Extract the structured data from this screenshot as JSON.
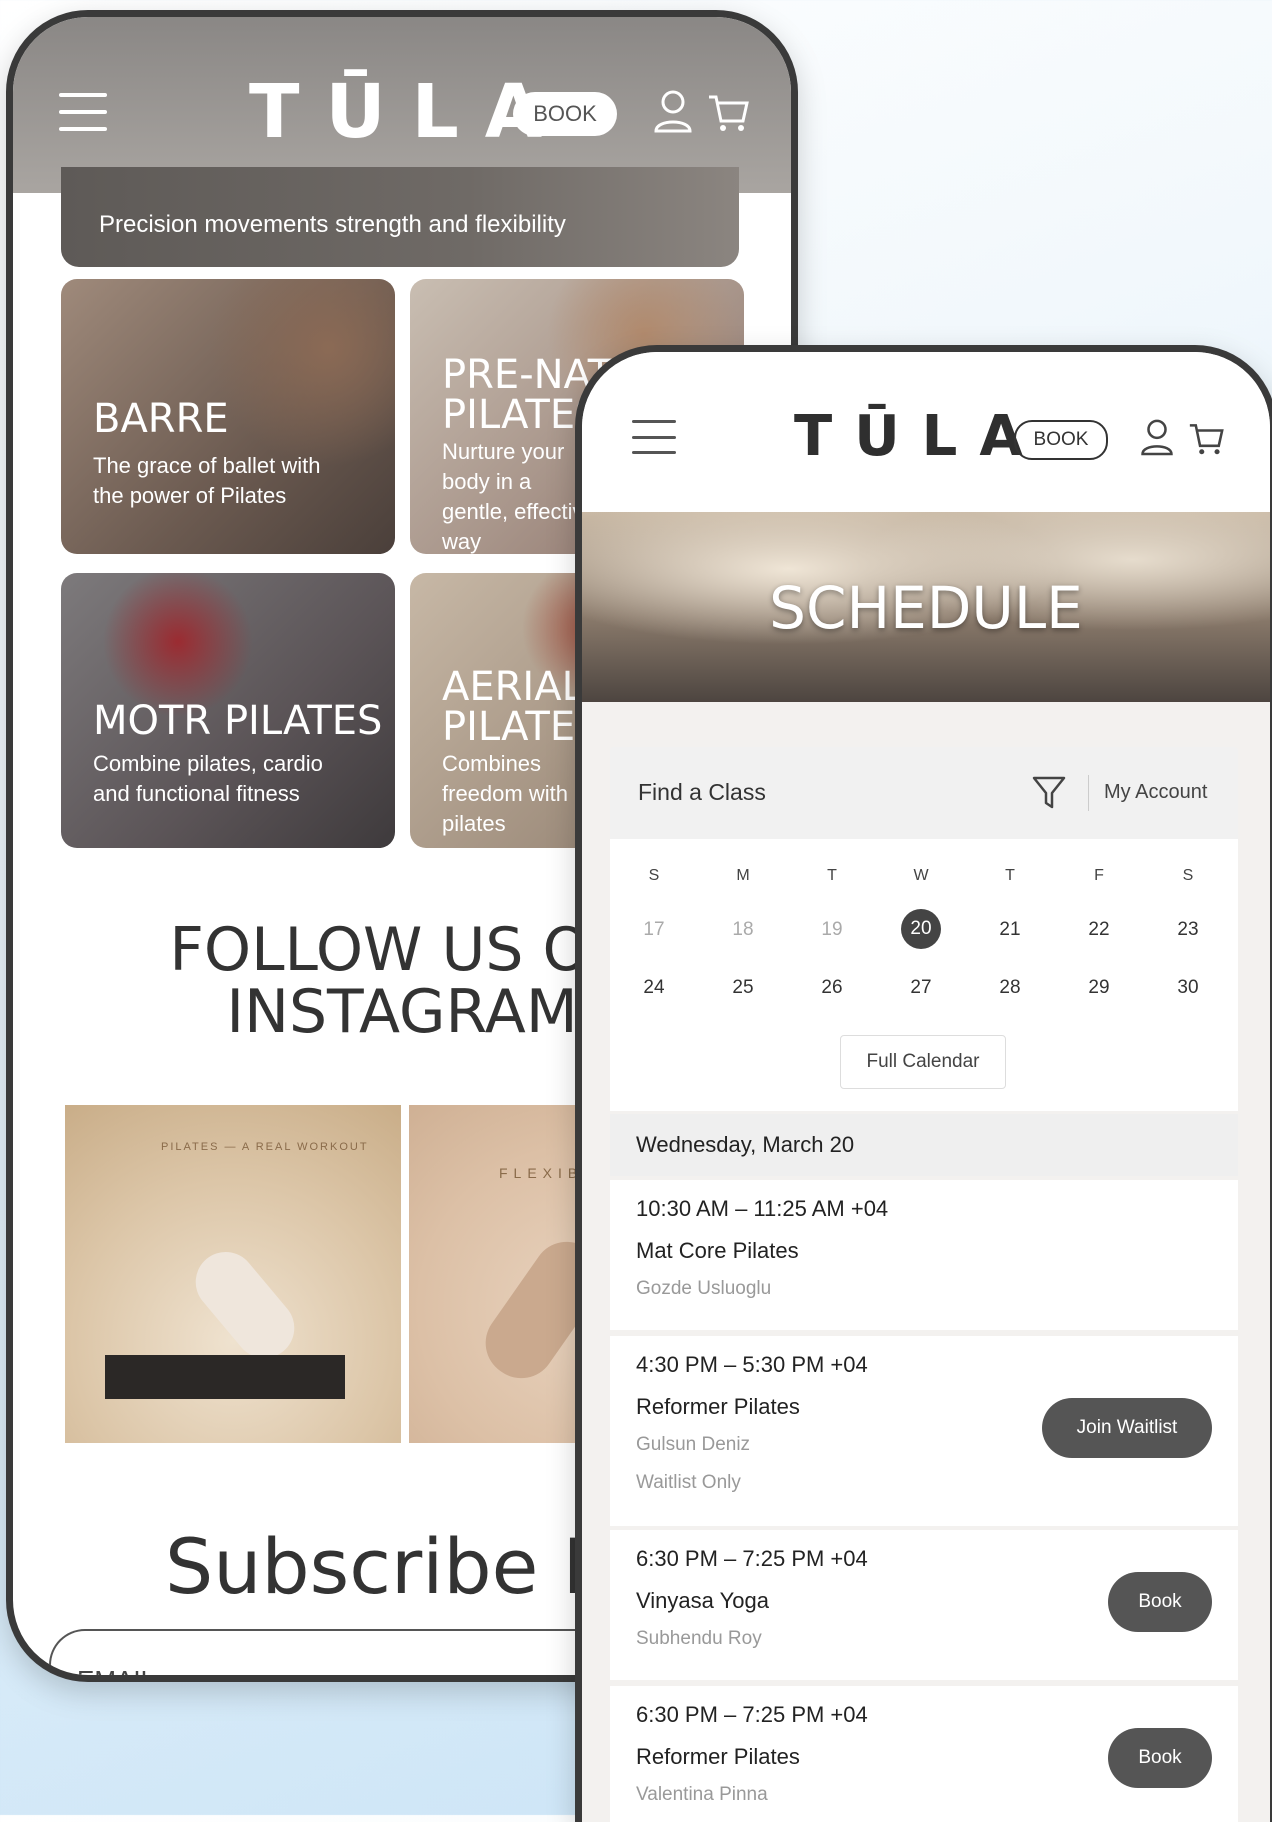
{
  "phone1": {
    "header": {
      "logo": "TŪLA",
      "book": "BOOK"
    },
    "hero_subtitle": "Precision movements strength and flexibility",
    "cards": [
      {
        "title": "BARRE",
        "subtitle": "The grace of ballet with the power of Pilates"
      },
      {
        "title": "PRE-NATAL PILATES",
        "subtitle": "Nurture your body in a gentle, effective way"
      },
      {
        "title": "MOTR PILATES",
        "subtitle": "Combine pilates, cardio and functional fitness"
      },
      {
        "title": "AERIAL PILATES",
        "subtitle": "Combines freedom with pilates"
      }
    ],
    "follow_heading_line1": "FOLLOW US ON",
    "follow_heading_line2": "INSTAGRAM",
    "insta_posts": [
      {
        "tag": "PILATES — A REAL WORKOUT"
      },
      {
        "tag": "FLEXIBILITY"
      }
    ],
    "subscribe_heading": "Subscribe Now",
    "email_placeholder": "EMAIL"
  },
  "phone2": {
    "header": {
      "logo": "TŪLA",
      "book": "BOOK"
    },
    "banner_title": "SCHEDULE",
    "find_class": "Find a Class",
    "my_account": "My Account",
    "weekdays": [
      "S",
      "M",
      "T",
      "W",
      "T",
      "F",
      "S"
    ],
    "week1": [
      "17",
      "18",
      "19",
      "20",
      "21",
      "22",
      "23"
    ],
    "week2": [
      "24",
      "25",
      "26",
      "27",
      "28",
      "29",
      "30"
    ],
    "selected_day": "20",
    "full_calendar": "Full Calendar",
    "day_heading": "Wednesday, March 20",
    "classes": [
      {
        "time": "10:30 AM – 11:25 AM +04",
        "name": "Mat Core Pilates",
        "instructor": "Gozde Usluoglu"
      },
      {
        "time": "4:30 PM – 5:30 PM +04",
        "name": "Reformer Pilates",
        "instructor": "Gulsun Deniz",
        "note": "Waitlist Only",
        "action": "Join Waitlist"
      },
      {
        "time": "6:30 PM – 7:25 PM +04",
        "name": "Vinyasa Yoga",
        "instructor": "Subhendu Roy",
        "action": "Book"
      },
      {
        "time": "6:30 PM – 7:25 PM +04",
        "name": "Reformer Pilates",
        "instructor": "Valentina Pinna",
        "action": "Book"
      }
    ]
  },
  "colors": {
    "frame": "#3a3a3a",
    "button_dark": "#555555",
    "accent_selected": "#444444"
  }
}
